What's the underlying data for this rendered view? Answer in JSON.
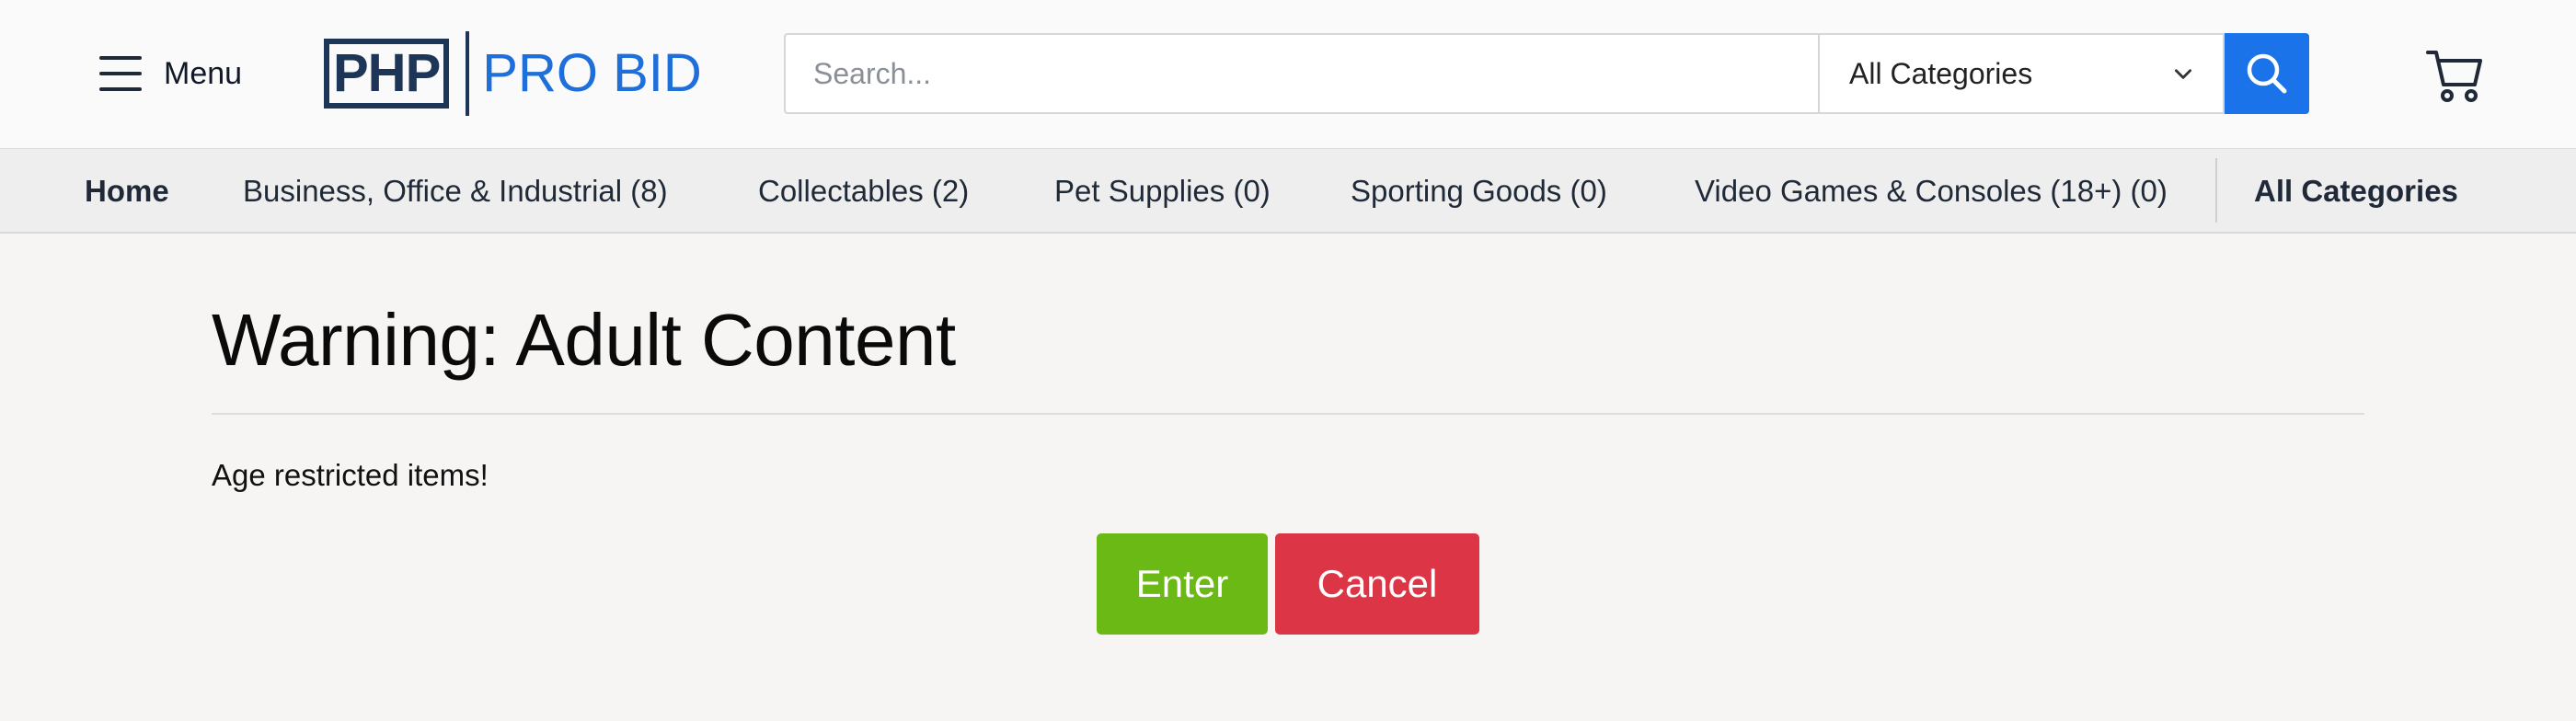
{
  "header": {
    "menu_label": "Menu",
    "logo_box_text": "PHP",
    "logo_text": "PRO BID",
    "search_placeholder": "Search...",
    "category_selected": "All Categories",
    "icons": {
      "menu": "hamburger-icon",
      "search": "search-icon",
      "cart": "cart-icon",
      "select": "chevron-down-icon"
    },
    "colors": {
      "brand_dark": "#1d3557",
      "brand_blue": "#1e6fd9",
      "search_button": "#1a73e8"
    }
  },
  "catnav": {
    "items": [
      "Home",
      "Business, Office & Industrial (8)",
      "Collectables (2)",
      "Pet Supplies (0)",
      "Sporting Goods (0)",
      "Video Games & Consoles (18+) (0)",
      "All Categories"
    ]
  },
  "main": {
    "title": "Warning: Adult Content",
    "message": "Age restricted items!",
    "enter_label": "Enter",
    "cancel_label": "Cancel",
    "colors": {
      "enter": "#6bb914",
      "cancel": "#dc3545"
    }
  }
}
